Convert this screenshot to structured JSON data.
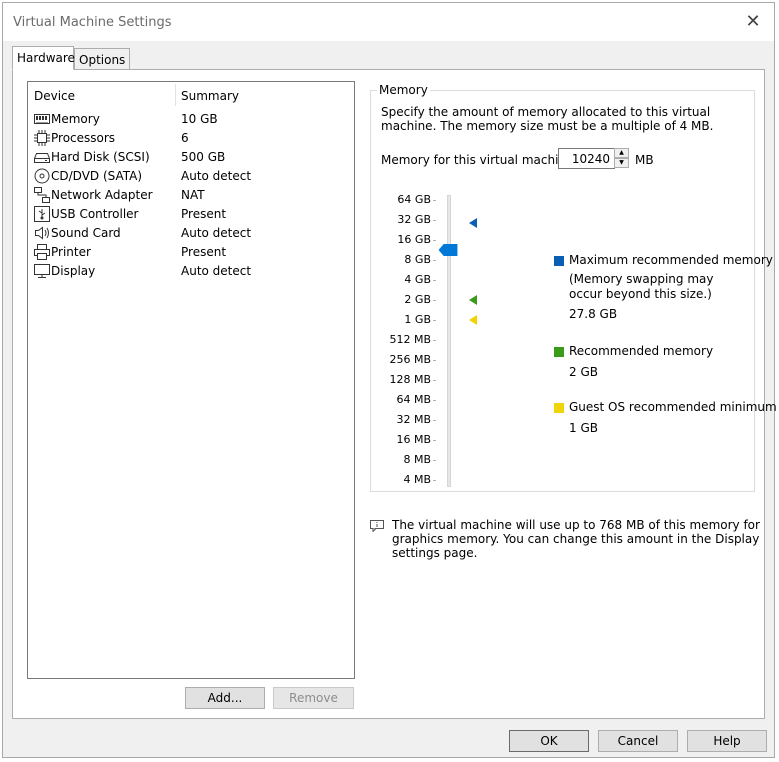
{
  "window": {
    "title": "Virtual Machine Settings",
    "close_glyph": "✕"
  },
  "tabs": [
    {
      "label": "Hardware",
      "active": true
    },
    {
      "label": "Options",
      "active": false
    }
  ],
  "device_list": {
    "col_device": "Device",
    "col_summary": "Summary",
    "items": [
      {
        "name": "Memory",
        "summary": "10 GB",
        "icon": "memory-icon"
      },
      {
        "name": "Processors",
        "summary": "6",
        "icon": "processor-icon"
      },
      {
        "name": "Hard Disk (SCSI)",
        "summary": "500 GB",
        "icon": "hard-disk-icon"
      },
      {
        "name": "CD/DVD (SATA)",
        "summary": "Auto detect",
        "icon": "cd-dvd-icon"
      },
      {
        "name": "Network Adapter",
        "summary": "NAT",
        "icon": "network-adapter-icon"
      },
      {
        "name": "USB Controller",
        "summary": "Present",
        "icon": "usb-controller-icon"
      },
      {
        "name": "Sound Card",
        "summary": "Auto detect",
        "icon": "sound-card-icon"
      },
      {
        "name": "Printer",
        "summary": "Present",
        "icon": "printer-icon"
      },
      {
        "name": "Display",
        "summary": "Auto detect",
        "icon": "display-icon"
      }
    ],
    "add_label": "Add...",
    "remove_label": "Remove"
  },
  "memory": {
    "group_label": "Memory",
    "description": "Specify the amount of memory allocated to this virtual machine. The memory size must be a multiple of 4 MB.",
    "field_label": "Memory for this virtual machine:",
    "value": "10240",
    "unit": "MB",
    "scale_labels": [
      "64 GB",
      "32 GB",
      "16 GB",
      "8 GB",
      "4 GB",
      "2 GB",
      "1 GB",
      "512 MB",
      "256 MB",
      "128 MB",
      "64 MB",
      "32 MB",
      "16 MB",
      "8 MB",
      "4 MB"
    ],
    "legend": {
      "max": {
        "title": "Maximum recommended memory",
        "note": "(Memory swapping may occur beyond this size.)",
        "value": "27.8 GB",
        "color": "#0a5fb4"
      },
      "recommended": {
        "title": "Recommended memory",
        "value": "2 GB",
        "color": "#3a9a1a"
      },
      "guest_min": {
        "title": "Guest OS recommended minimum",
        "value": "1 GB",
        "color": "#f2d30a"
      }
    },
    "thumb_color": "#0078d7"
  },
  "note": "The virtual machine will use up to 768 MB of this memory for graphics memory. You can change this amount in the Display settings page.",
  "footer": {
    "ok": "OK",
    "cancel": "Cancel",
    "help": "Help"
  }
}
